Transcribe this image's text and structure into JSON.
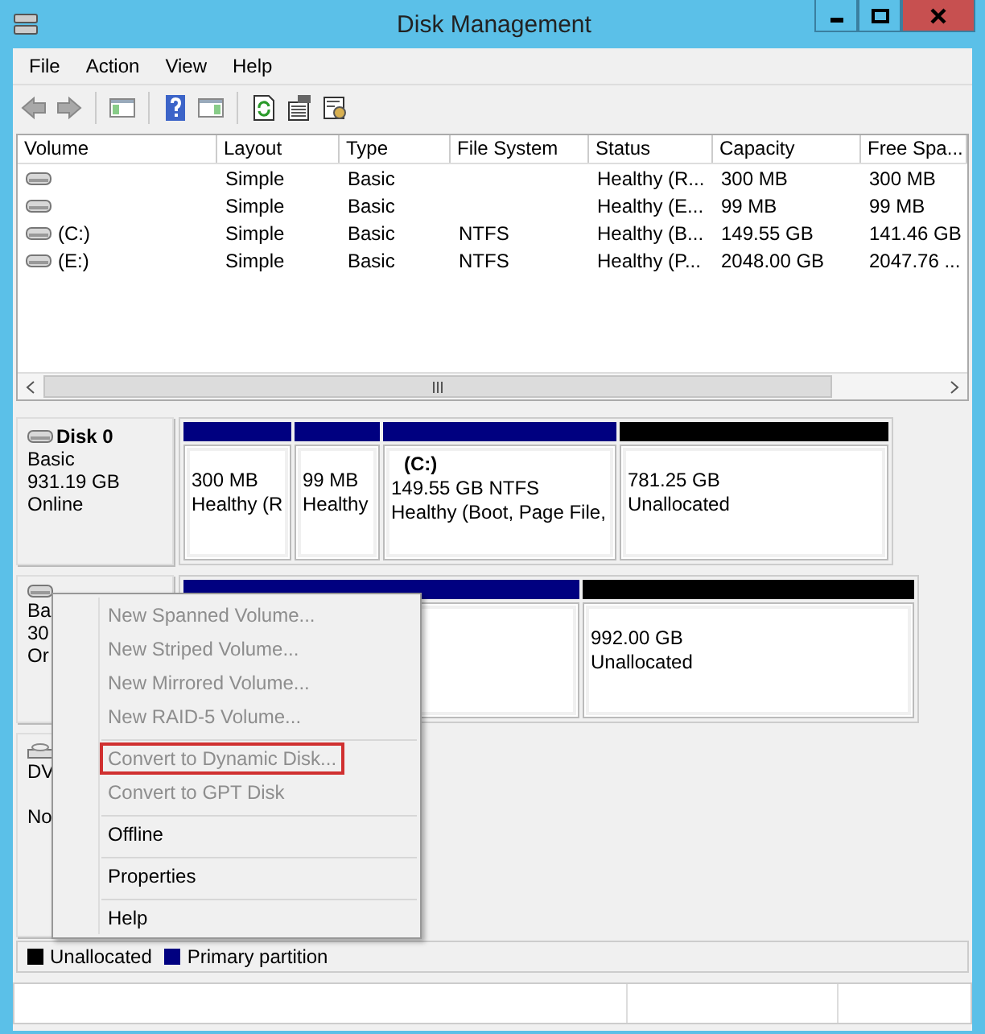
{
  "window": {
    "title": "Disk Management"
  },
  "menu_bar": [
    "File",
    "Action",
    "View",
    "Help"
  ],
  "volume_list": {
    "columns": [
      "Volume",
      "Layout",
      "Type",
      "File System",
      "Status",
      "Capacity",
      "Free Spa..."
    ],
    "rows": [
      {
        "layout": "Simple",
        "type": "Basic",
        "status": "Healthy (R...",
        "capacity": "300 MB",
        "free_space": "300 MB"
      },
      {
        "layout": "Simple",
        "type": "Basic",
        "status": "Healthy (E...",
        "capacity": "99 MB",
        "free_space": "99 MB"
      },
      {
        "volume": "(C:)",
        "layout": "Simple",
        "type": "Basic",
        "file_system": "NTFS",
        "status": "Healthy (B...",
        "capacity": "149.55 GB",
        "free_space": "141.46 GB"
      },
      {
        "volume": "(E:)",
        "layout": "Simple",
        "type": "Basic",
        "file_system": "NTFS",
        "status": "Healthy (P...",
        "capacity": "2048.00 GB",
        "free_space": "2047.76 ..."
      }
    ]
  },
  "disks": [
    {
      "name": "Disk 0",
      "lines": [
        "Basic",
        "931.19 GB",
        "Online"
      ],
      "kind": "disk",
      "partitions": [
        {
          "kind": "primary",
          "lines": [
            "300 MB",
            "Healthy (R"
          ]
        },
        {
          "kind": "primary",
          "lines": [
            "99 MB",
            "Healthy"
          ]
        },
        {
          "kind": "primary",
          "title": "(C:)",
          "lines": [
            "149.55 GB NTFS",
            "Healthy (Boot, Page File,"
          ]
        },
        {
          "kind": "unallocated",
          "lines": [
            "781.25 GB",
            "Unallocated"
          ]
        }
      ]
    },
    {
      "lines": [
        "Ba",
        "30",
        "Or"
      ],
      "kind": "disk",
      "partitions": [
        {
          "kind": "primary"
        },
        {
          "kind": "unallocated",
          "lines": [
            "992.00 GB",
            "Unallocated"
          ]
        }
      ]
    },
    {
      "lines": [
        "DV",
        "No"
      ],
      "kind": "dvd"
    }
  ],
  "context_menu": [
    {
      "label": "New Spanned Volume...",
      "disabled": true,
      "separator_before": false,
      "highlighted": false
    },
    {
      "label": "New Striped Volume...",
      "disabled": true,
      "separator_before": false,
      "highlighted": false
    },
    {
      "label": "New Mirrored Volume...",
      "disabled": true,
      "separator_before": false,
      "highlighted": false
    },
    {
      "label": "New RAID-5 Volume...",
      "disabled": true,
      "separator_before": false,
      "highlighted": false
    },
    {
      "label": "Convert to Dynamic Disk...",
      "disabled": true,
      "separator_before": true,
      "highlighted": true
    },
    {
      "label": "Convert to GPT Disk",
      "disabled": true,
      "separator_before": false,
      "highlighted": false
    },
    {
      "label": "Offline",
      "disabled": false,
      "separator_before": true,
      "highlighted": false
    },
    {
      "label": "Properties",
      "disabled": false,
      "separator_before": true,
      "highlighted": false
    },
    {
      "label": "Help",
      "disabled": false,
      "separator_before": true,
      "highlighted": false
    }
  ],
  "legend": [
    {
      "label": "Unallocated",
      "kind": "unallocated"
    },
    {
      "label": "Primary partition",
      "kind": "primary"
    }
  ]
}
